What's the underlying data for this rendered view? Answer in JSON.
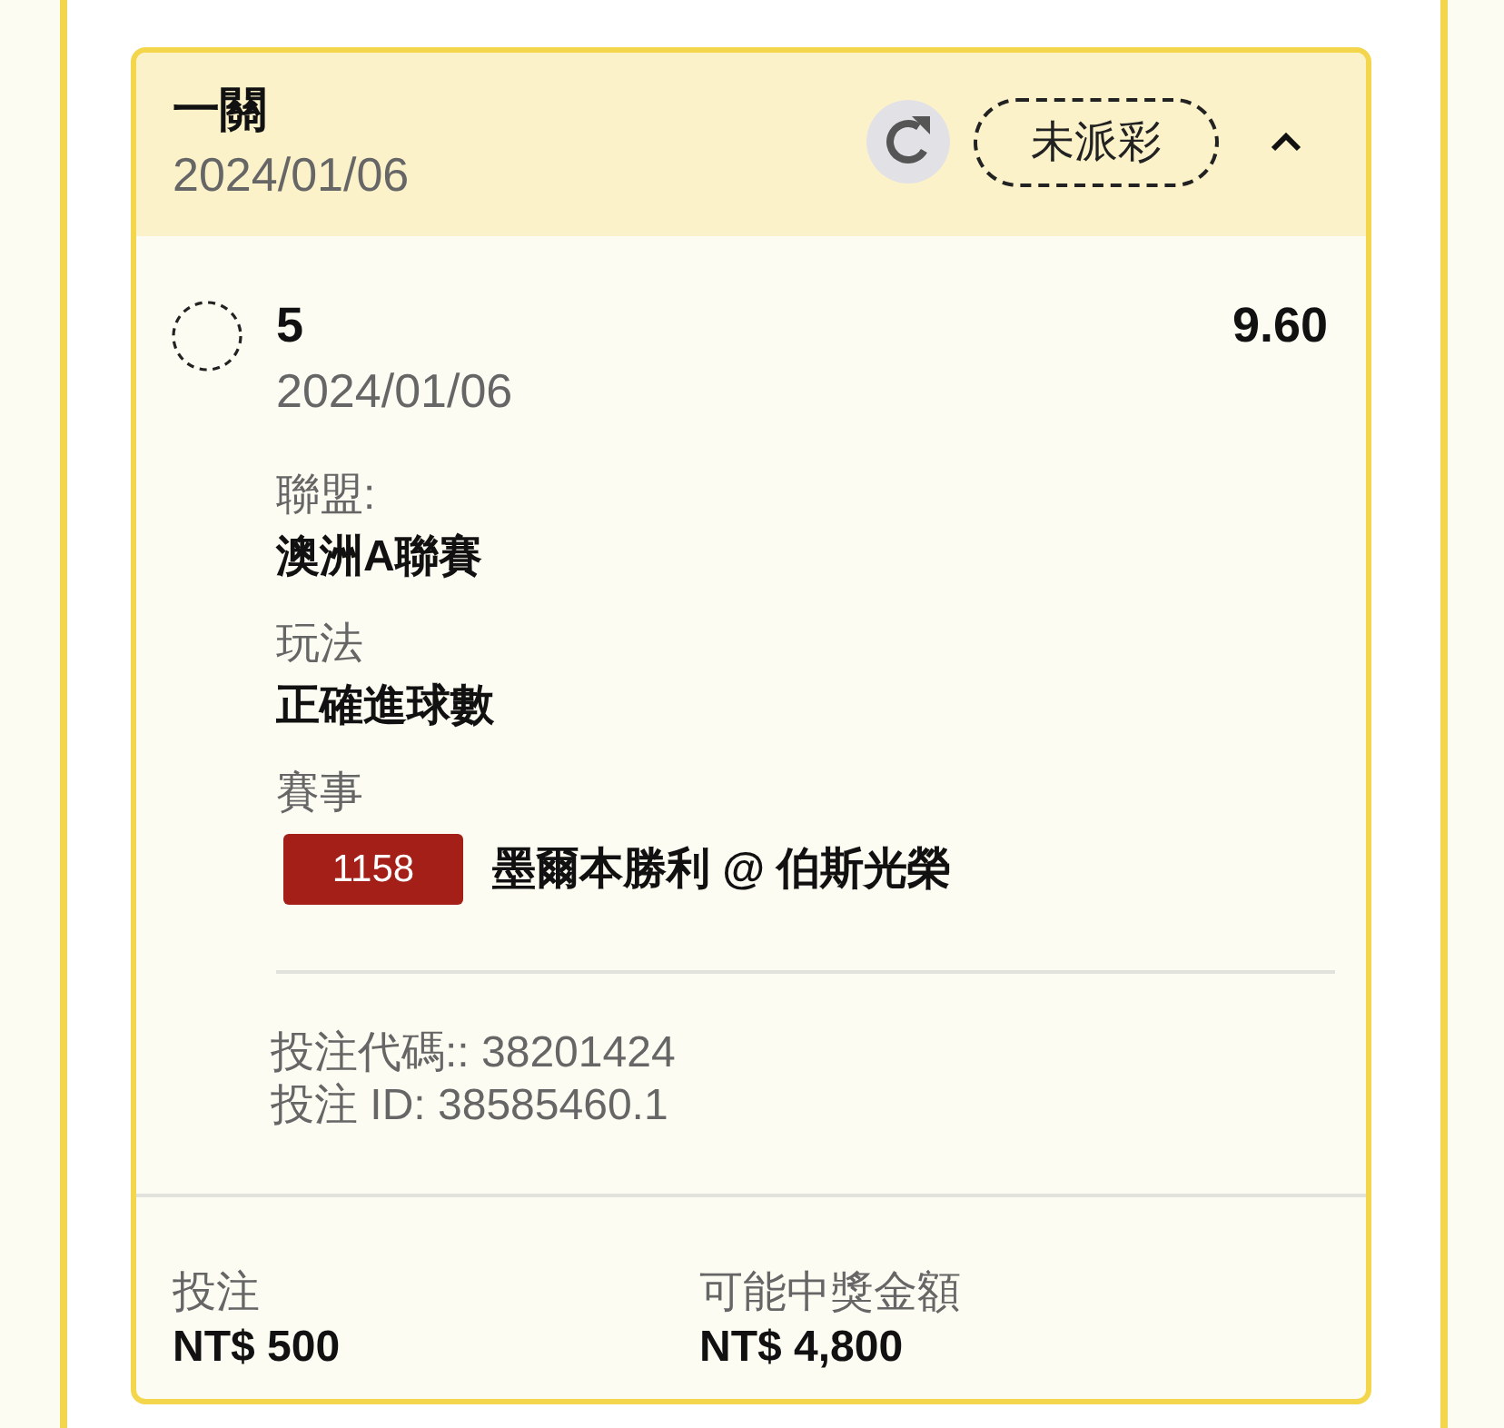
{
  "bet": {
    "title": "一關",
    "date": "2024/01/06",
    "status": "未派彩",
    "expanded": true
  },
  "leg": {
    "kind": "pending",
    "pick": "5",
    "odds": "9.60",
    "date": "2024/01/06"
  },
  "fields": [
    {
      "label": "聯盟:",
      "value": "澳洲A聯賽"
    },
    {
      "label": "玩法",
      "value": "正確進球數"
    },
    {
      "label": "賽事",
      "match_code": "1158",
      "value": "墨爾本勝利 @ 伯斯光榮"
    }
  ],
  "references": [
    "投注代碼:: 38201424",
    "投注 ID: 38585460.1"
  ],
  "summary": [
    {
      "label": "投注",
      "value": "NT$ 500"
    },
    {
      "label": "可能中獎金額",
      "value": "NT$ 4,800"
    }
  ]
}
